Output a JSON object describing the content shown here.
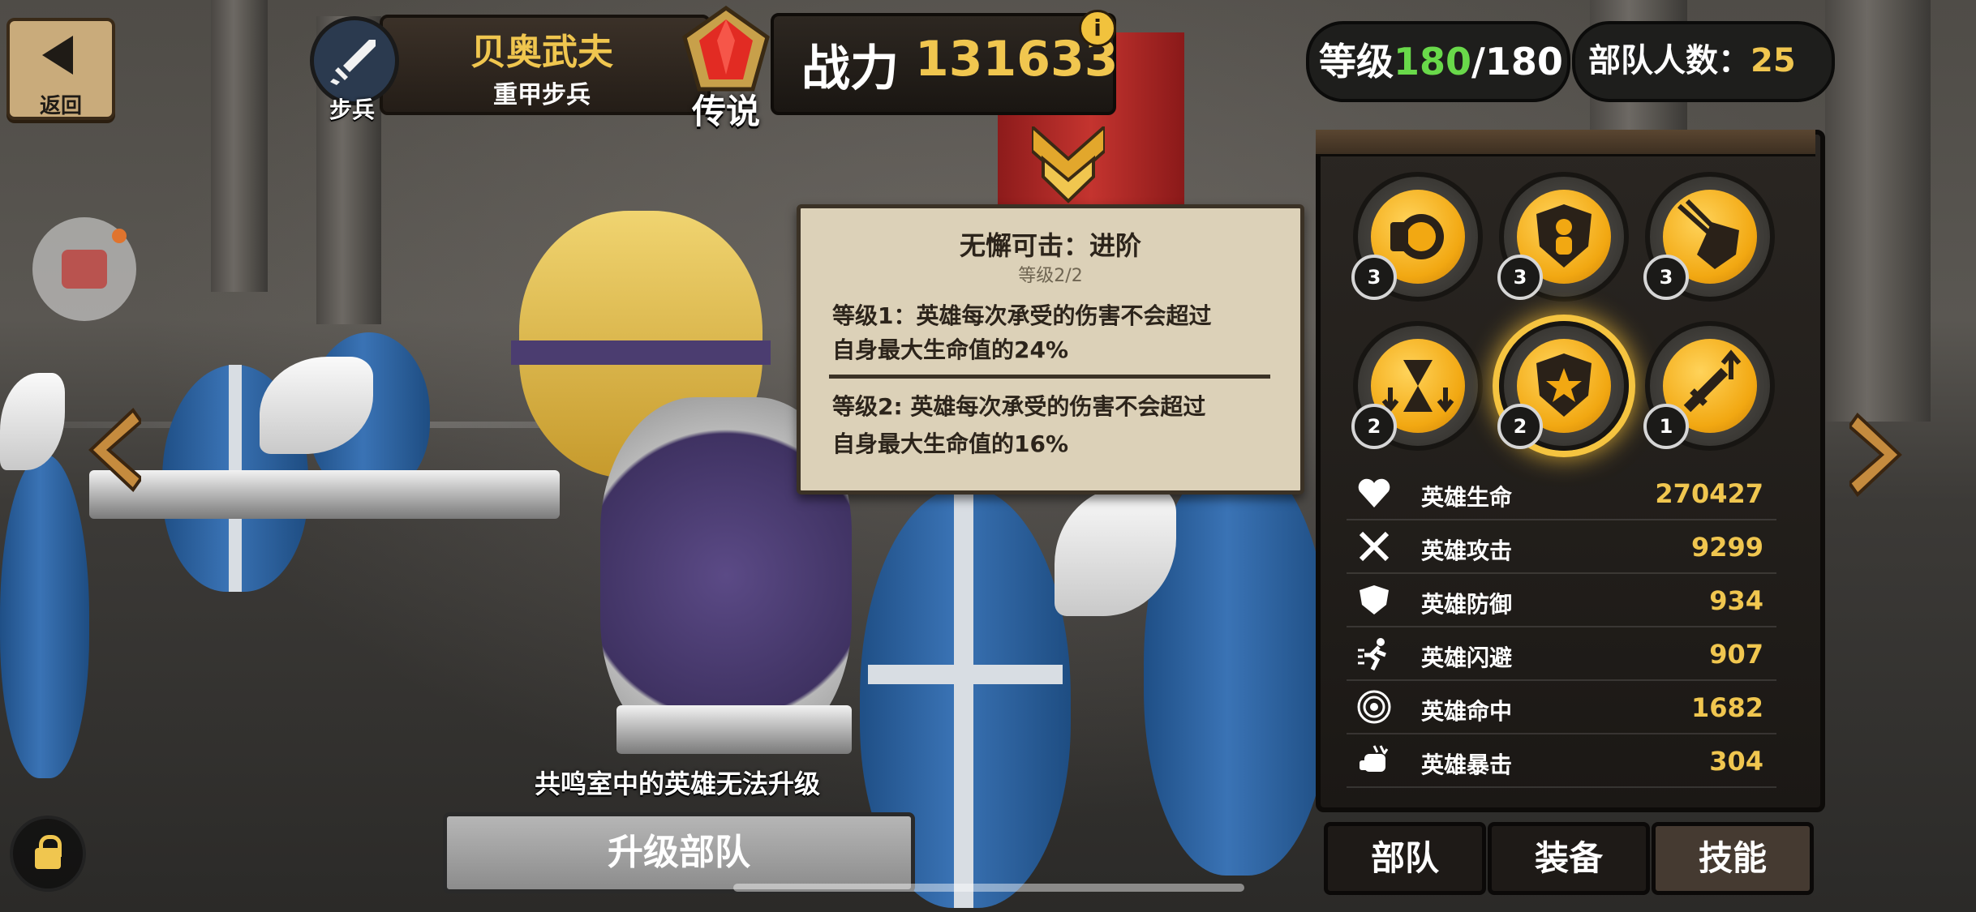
{
  "topbar": {
    "back_label": "返回",
    "class_label": "步兵",
    "hero_name": "贝奥武夫",
    "hero_subtitle": "重甲步兵",
    "rarity_label": "传说",
    "power_label": "战力",
    "power_value": "131633",
    "info_label": "i",
    "level_label": "等级",
    "level_current": "180",
    "level_max": "/180",
    "troop_label": "部队人数：",
    "troop_value": "25"
  },
  "tooltip": {
    "title": "无懈可击：进阶",
    "level": "等级2/2",
    "line1a": "等级1：英雄每次承受的伤害不会超过",
    "line1b": "自身最大生命值的24%",
    "line2a": "等级2: 英雄每次承受的伤害不会超过",
    "line2b": "自身最大生命值的16%"
  },
  "skills": [
    {
      "icon": "clock-shield-icon",
      "level": "3"
    },
    {
      "icon": "person-shield-icon",
      "level": "3"
    },
    {
      "icon": "arrows-shield-icon",
      "level": "3"
    },
    {
      "icon": "hourglass-icon",
      "level": "2"
    },
    {
      "icon": "burst-shield-icon",
      "level": "2",
      "selected": true
    },
    {
      "icon": "sword-up-icon",
      "level": "1"
    }
  ],
  "stats": [
    {
      "icon": "heart-icon",
      "name": "英雄生命",
      "value": "270427"
    },
    {
      "icon": "crossed-swords-icon",
      "name": "英雄攻击",
      "value": "9299"
    },
    {
      "icon": "shield-icon",
      "name": "英雄防御",
      "value": "934"
    },
    {
      "icon": "running-icon",
      "name": "英雄闪避",
      "value": "907"
    },
    {
      "icon": "target-icon",
      "name": "英雄命中",
      "value": "1682"
    },
    {
      "icon": "fist-icon",
      "name": "英雄暴击",
      "value": "304"
    }
  ],
  "tabs": [
    "部队",
    "装备",
    "技能"
  ],
  "active_tab": "技能",
  "upgrade": {
    "note": "共鸣室中的英雄无法升级",
    "button": "升级部队"
  },
  "colors": {
    "gold": "#f0c64f",
    "level_green": "#69d94a",
    "tooltip_bg": "#dcd1b8",
    "panel_bg": "#1b1815"
  }
}
